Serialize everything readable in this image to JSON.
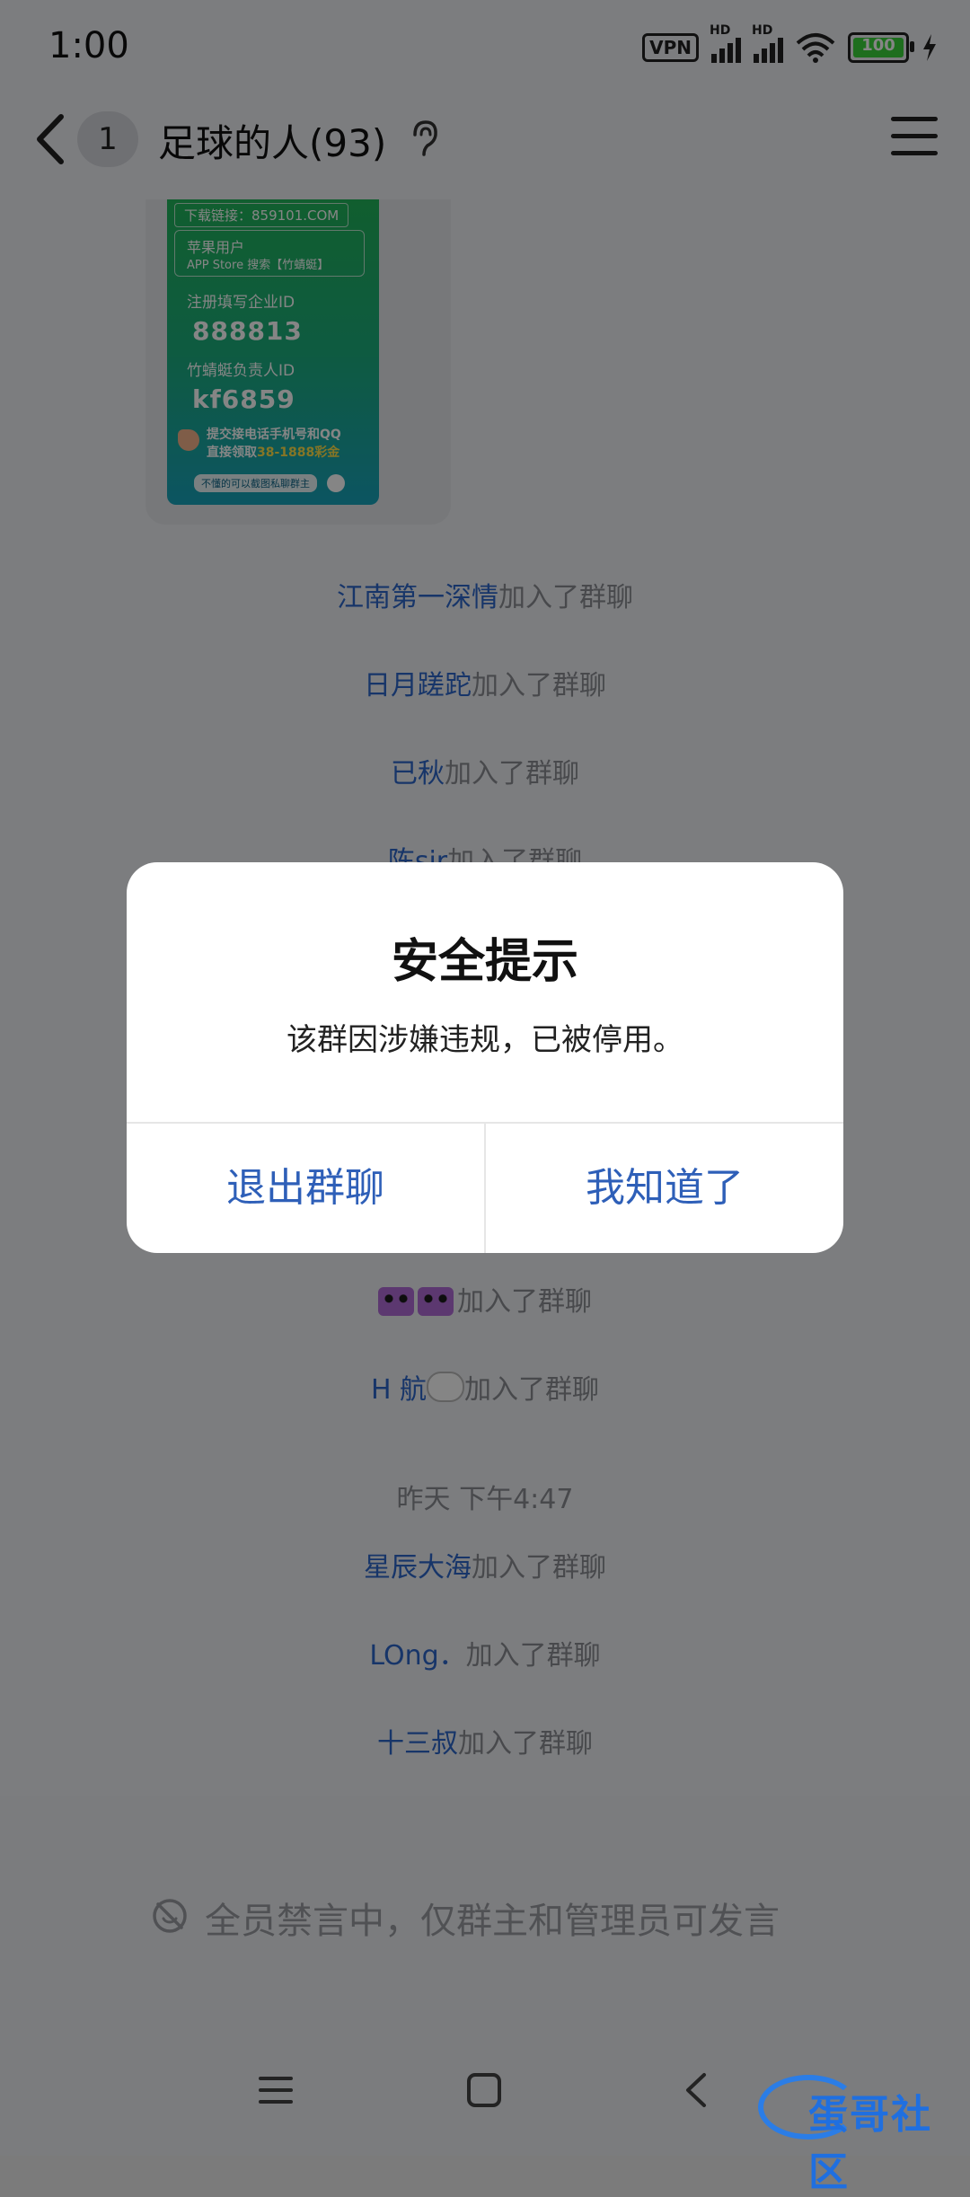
{
  "status_bar": {
    "time": "1:00",
    "vpn": "VPN",
    "hd": "HD",
    "battery": "100"
  },
  "header": {
    "unread_count": "1",
    "title": "足球的人(93)"
  },
  "promo_image": {
    "download": "下载链接：859101.COM",
    "apple_title": "苹果用户",
    "apple_sub": "APP Store 搜索【竹蜻蜓】",
    "company_label": "注册填写企业ID",
    "company_id": "888813",
    "owner_label": "竹蜻蜓负责人ID",
    "owner_id": "kf6859",
    "offer_line1": "提交接电话手机号和QQ",
    "offer_line2_prefix": "直接领取",
    "offer_line2_highlight": "38-1888彩金",
    "footer": "不懂的可以截图私聊群主"
  },
  "messages": [
    {
      "name": "江南第一深情",
      "suffix": "加入了群聊"
    },
    {
      "name": "日月蹉跎",
      "suffix": "加入了群聊"
    },
    {
      "name": "已秋",
      "suffix": "加入了群聊"
    },
    {
      "name": "陈sir",
      "suffix": "加入了群聊"
    },
    {
      "name": "",
      "suffix": "加入了群聊"
    },
    {
      "name": "H 航",
      "suffix": "加入了群聊"
    },
    {
      "name": "星辰大海",
      "suffix": "加入了群聊"
    },
    {
      "name": "LOng．",
      "suffix": "加入了群聊"
    },
    {
      "name": "十三叔",
      "suffix": "加入了群聊"
    }
  ],
  "timestamp": "昨天 下午4:47",
  "mute_notice": "全员禁言中，仅群主和管理员可发言",
  "dialog": {
    "title": "安全提示",
    "message": "该群因涉嫌违规，已被停用。",
    "left_button": "退出群聊",
    "right_button": "我知道了"
  },
  "watermark": "蛋哥社区",
  "colors": {
    "link": "#2c66c9",
    "dialog_button": "#2e5fb8",
    "promo_green": "#21b45a",
    "battery": "#3ad43a"
  }
}
